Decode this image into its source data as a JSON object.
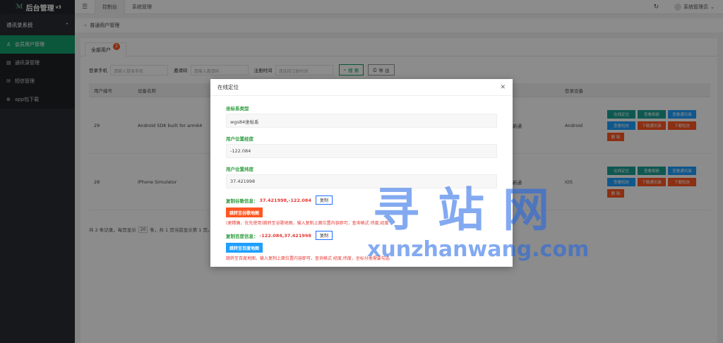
{
  "app": {
    "logo_mark": "ℳ",
    "title": "后台管理",
    "version": "v3"
  },
  "sidebar": {
    "group_label": "通讯录系统",
    "items": [
      {
        "label": "会员用户管理",
        "icon": "user-icon"
      },
      {
        "label": "通讯录管理",
        "icon": "book-icon"
      },
      {
        "label": "短信管理",
        "icon": "message-icon"
      },
      {
        "label": "app包下载",
        "icon": "download-icon"
      }
    ]
  },
  "topbar": {
    "tabs": [
      "控制台",
      "系统管理"
    ],
    "user": "系统管理员"
  },
  "breadcrumb": "普通用户管理",
  "card": {
    "tab_label": "全部用户",
    "tab_badge": "2"
  },
  "filters": {
    "phone_label": "登录手机",
    "phone_placeholder": "请输入登录手机",
    "invite_label": "邀请码",
    "invite_placeholder": "请输入邀请码",
    "time_label": "注册时间",
    "time_placeholder": "请选择注册时间",
    "search_label": "搜 索",
    "export_label": "导 出"
  },
  "table": {
    "headers": [
      "用户编号",
      "设备名称",
      "登录设备"
    ],
    "rows": [
      {
        "id": "29",
        "device": "Android SDK built for arm64",
        "mid": "新通",
        "login": "Android"
      },
      {
        "id": "28",
        "device": "iPhone Simulator",
        "mid": "新通",
        "login": "iOS"
      }
    ],
    "actions": {
      "locate": "在线定位",
      "view_album": "查看相册",
      "view_contacts": "查看通讯录",
      "view_sms": "查看短信",
      "download_contacts": "下载通讯录",
      "download_sms": "下载短信",
      "delete": "删 除"
    }
  },
  "pager": {
    "prefix": "共 2 条记录，每页显示",
    "page_size": "20",
    "suffix": "条，共 1 页当前显示第 1 页。"
  },
  "modal": {
    "title": "在线定位",
    "coord_type_label": "坐标系类型",
    "coord_type_value": "wgs84坐标系",
    "longitude_label": "用户位置经度",
    "longitude_value": "-122.084",
    "latitude_label": "用户位置纬度",
    "latitude_value": "37.421998",
    "google_copy_label": "复制谷歌信息：",
    "google_copy_value": "37.421998,-122.084",
    "copy_button": "复制",
    "google_map_button": "跳转至谷歌地图",
    "google_hint": "(更精确，优先使用)跳转至谷歌地图，输入复制上面位置内容即可，查询格式 纬度,经度",
    "baidu_copy_label": "复制百度信息：",
    "baidu_copy_value": "-122.084,37.421998",
    "baidu_map_button": "跳转至百度地图",
    "baidu_hint": "跳转至百度地图，输入复制上面位置内容即可，查询格式 经度,纬度，坐标分类需要勾选"
  },
  "watermark": {
    "cn": "寻站网",
    "en": "xunzhanwang.com"
  }
}
